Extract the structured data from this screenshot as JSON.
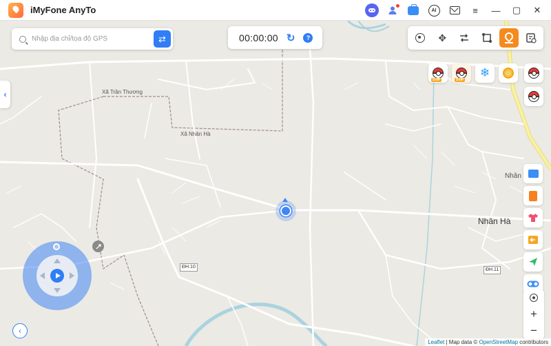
{
  "app": {
    "title": "iMyFone AnyTo"
  },
  "titlebar": {
    "icons": [
      "discord-icon",
      "user-icon",
      "briefcase-icon",
      "ai-icon",
      "mail-icon",
      "menu-icon",
      "minimize-icon",
      "maximize-icon",
      "close-icon"
    ],
    "ai_text": "AI",
    "menu_glyph": "≡",
    "minimize_glyph": "—",
    "maximize_glyph": "▢",
    "close_glyph": "✕"
  },
  "search": {
    "placeholder": "Nhập địa chỉ/tọa độ GPS",
    "value": "",
    "go_glyph": "⇄"
  },
  "timer": {
    "value": "00:00:00",
    "refresh_glyph": "↻",
    "help_glyph": "?"
  },
  "mode_bar": {
    "modes": [
      "teleport",
      "joystick",
      "two-spot",
      "multi-spot",
      "jump",
      "history"
    ],
    "active": "jump",
    "move_glyph": "✥"
  },
  "poke_tools": {
    "badge": "SVIP",
    "snow_glyph": "❄",
    "coin_glyph": "☺"
  },
  "map": {
    "labels": {
      "xa_tran_thuong": "Xã Trần Thương",
      "xa_nhan_ha": "Xã Nhân Hà",
      "nhan_ha": "Nhân Hà",
      "nhan_edge": "Nhân"
    },
    "shields": {
      "dh10": "ĐH.10",
      "dh11": "ĐH.11"
    },
    "colors": {
      "road": "#ffffff",
      "water": "#aad3df",
      "boundary": "#9e8a9c",
      "yellow_road": "#f7f2a5",
      "background": "#eceae4"
    }
  },
  "controls": {
    "side_tab_glyph": "‹",
    "back_glyph": "‹",
    "zoom_in": "+",
    "zoom_out": "−"
  },
  "attribution": {
    "leaflet": "Leaflet",
    "sep": " | Map data © ",
    "osm": "OpenStreetMap",
    "contrib": " contributors"
  }
}
